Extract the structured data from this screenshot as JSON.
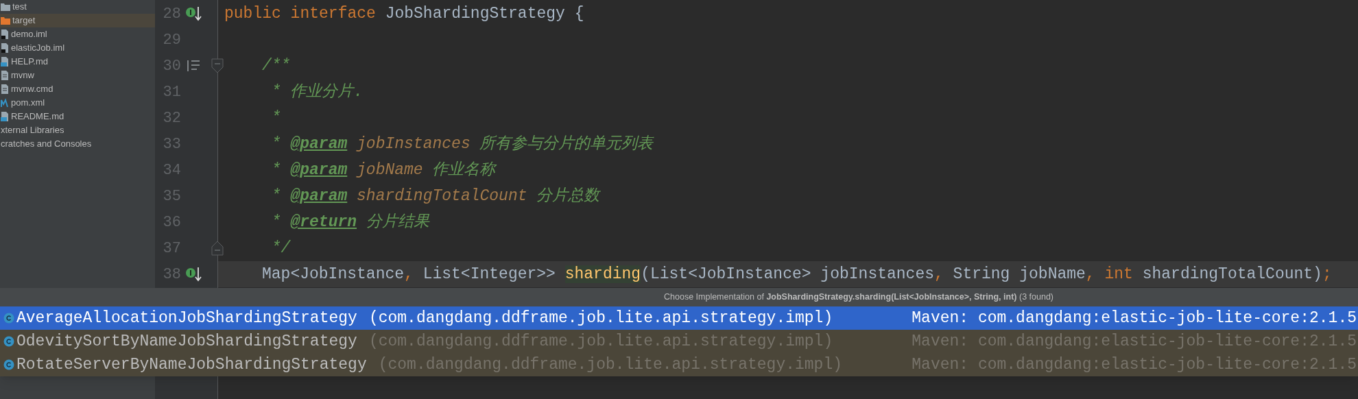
{
  "sidebar": {
    "items": [
      {
        "label": "test",
        "kind": "folder",
        "selected": false
      },
      {
        "label": "target",
        "kind": "excluded-folder",
        "selected": true
      },
      {
        "label": "demo.iml",
        "kind": "module-file",
        "selected": false
      },
      {
        "label": "elasticJob.iml",
        "kind": "module-file",
        "selected": false
      },
      {
        "label": "HELP.md",
        "kind": "markdown-file",
        "selected": false
      },
      {
        "label": "mvnw",
        "kind": "text-file",
        "selected": false
      },
      {
        "label": "mvnw.cmd",
        "kind": "text-file",
        "selected": false
      },
      {
        "label": "pom.xml",
        "kind": "maven-file",
        "selected": false
      },
      {
        "label": "README.md",
        "kind": "markdown-file",
        "selected": false
      },
      {
        "label": "xternal Libraries",
        "kind": "group",
        "selected": false
      },
      {
        "label": "cratches and Consoles",
        "kind": "group",
        "selected": false
      }
    ]
  },
  "editor": {
    "lines": [
      {
        "number": "28",
        "kind": "type-declaration",
        "current": false,
        "tokens": [
          {
            "kind": "keyword",
            "text": "public interface "
          },
          {
            "kind": "plain",
            "text": "JobShardingStrategy {"
          }
        ]
      },
      {
        "number": "29",
        "kind": "blank",
        "current": false
      },
      {
        "number": "30",
        "kind": "doc-start",
        "current": false,
        "tokens": [
          {
            "kind": "doc",
            "text": "/**"
          }
        ]
      },
      {
        "number": "31",
        "kind": "doc",
        "current": false,
        "tokens": [
          {
            "kind": "doc",
            "text": " * 作业分片."
          }
        ]
      },
      {
        "number": "32",
        "kind": "doc",
        "current": false,
        "tokens": [
          {
            "kind": "doc",
            "text": " *"
          }
        ]
      },
      {
        "number": "33",
        "kind": "doc",
        "current": false,
        "tokens": [
          {
            "kind": "doc",
            "text": " * "
          },
          {
            "kind": "tag",
            "text": "@param"
          },
          {
            "kind": "param",
            "text": " jobInstances "
          },
          {
            "kind": "doc",
            "text": "所有参与分片的单元列表"
          }
        ]
      },
      {
        "number": "34",
        "kind": "doc",
        "current": false,
        "tokens": [
          {
            "kind": "doc",
            "text": " * "
          },
          {
            "kind": "tag",
            "text": "@param"
          },
          {
            "kind": "param",
            "text": " jobName "
          },
          {
            "kind": "doc",
            "text": "作业名称"
          }
        ]
      },
      {
        "number": "35",
        "kind": "doc",
        "current": false,
        "tokens": [
          {
            "kind": "doc",
            "text": " * "
          },
          {
            "kind": "tag",
            "text": "@param"
          },
          {
            "kind": "param",
            "text": " shardingTotalCount "
          },
          {
            "kind": "doc",
            "text": "分片总数"
          }
        ]
      },
      {
        "number": "36",
        "kind": "doc",
        "current": false,
        "tokens": [
          {
            "kind": "doc",
            "text": " * "
          },
          {
            "kind": "tag",
            "text": "@return"
          },
          {
            "kind": "doc",
            "text": " 分片结果"
          }
        ]
      },
      {
        "number": "37",
        "kind": "doc-end",
        "current": false,
        "tokens": [
          {
            "kind": "doc",
            "text": " */"
          }
        ]
      },
      {
        "number": "38",
        "kind": "method-declaration",
        "current": true,
        "tokens": [
          {
            "kind": "plain",
            "text": "Map<JobInstance"
          },
          {
            "kind": "punct",
            "text": ", "
          },
          {
            "kind": "plain",
            "text": "List<Integer>> "
          },
          {
            "kind": "method",
            "text": "sharding"
          },
          {
            "kind": "plain",
            "text": "(List<JobInstance> jobInstances"
          },
          {
            "kind": "punct",
            "text": ", "
          },
          {
            "kind": "plain",
            "text": "String jobName"
          },
          {
            "kind": "punct",
            "text": ", "
          },
          {
            "kind": "keyword",
            "text": "int "
          },
          {
            "kind": "plain",
            "text": "shardingTotalCount)"
          },
          {
            "kind": "punct",
            "text": ";"
          }
        ]
      }
    ]
  },
  "popup": {
    "title": "Choose Implementation of **JobShardingStrategy.sharding(List<JobInstance>, String, int)** (3 found)",
    "items": [
      {
        "name": "AverageAllocationJobShardingStrategy",
        "package": "(com.dangdang.ddframe.job.lite.api.strategy.impl)",
        "location": "Maven: com.dangdang:elastic-job-lite-core:2.1.5",
        "selected": true
      },
      {
        "name": "OdevitySortByNameJobShardingStrategy",
        "package": "(com.dangdang.ddframe.job.lite.api.strategy.impl)",
        "location": "Maven: com.dangdang:elastic-job-lite-core:2.1.5",
        "selected": false
      },
      {
        "name": "RotateServerByNameJobShardingStrategy",
        "package": "(com.dangdang.ddframe.job.lite.api.strategy.impl)",
        "location": "Maven: com.dangdang:elastic-job-lite-core:2.1.5",
        "selected": false
      }
    ]
  }
}
